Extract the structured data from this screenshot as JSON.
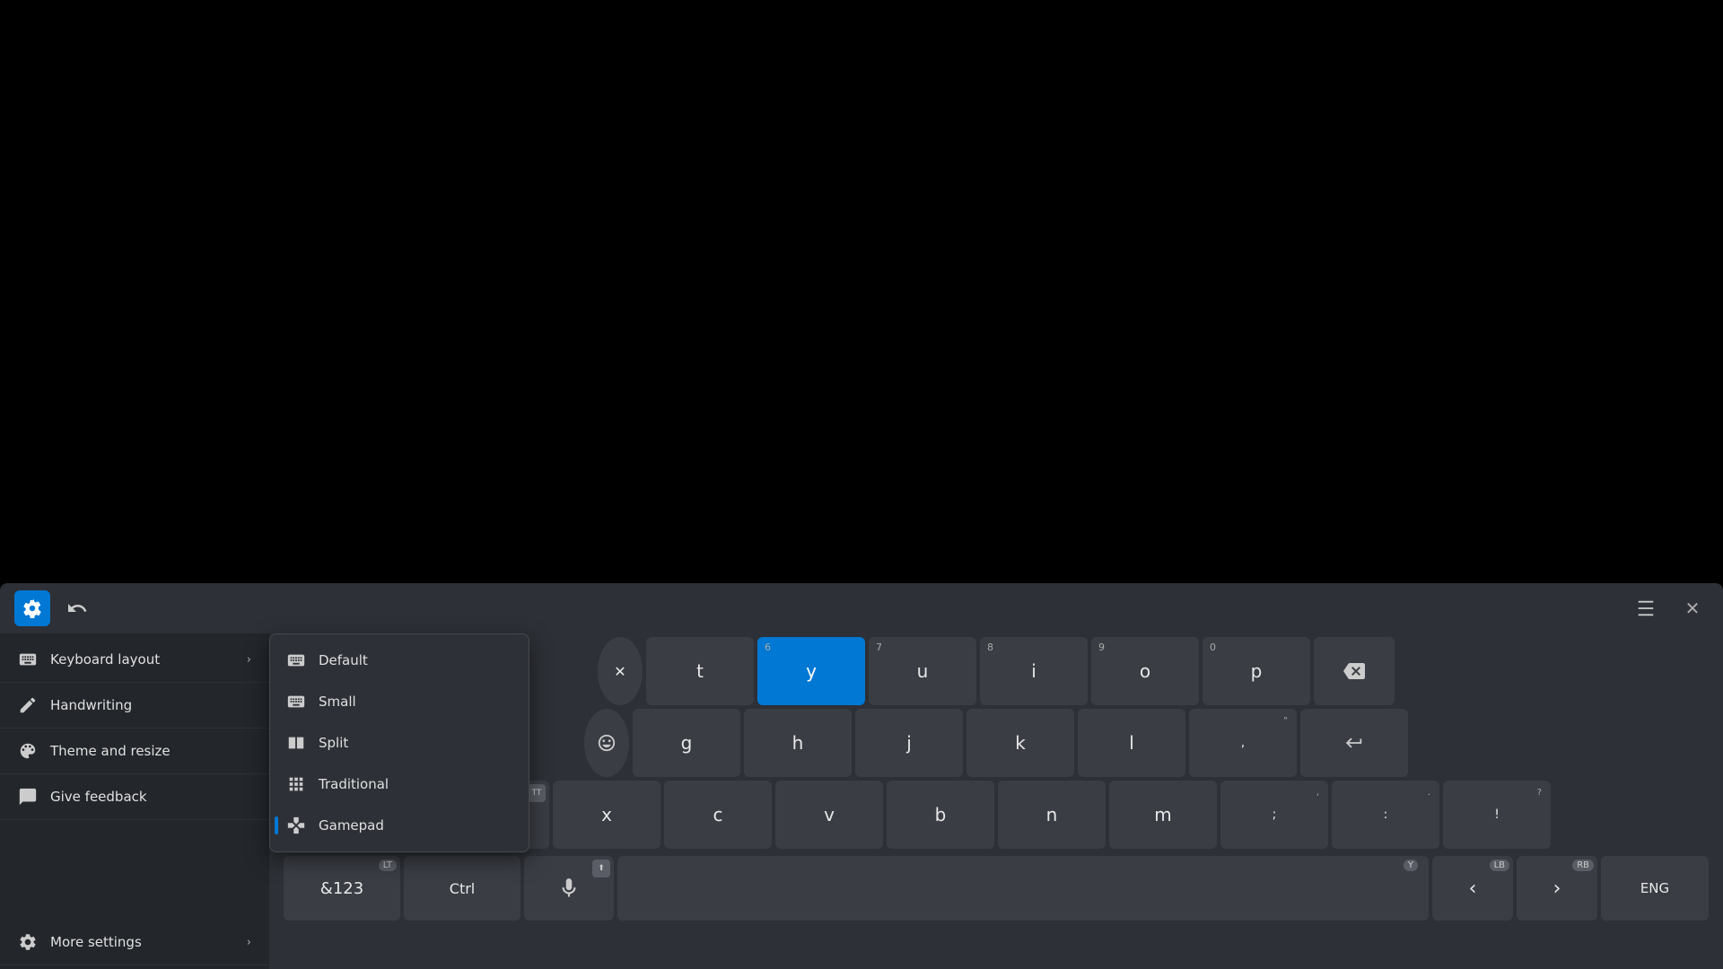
{
  "header": {
    "gear_label": "Settings",
    "dock_label": "Dock",
    "close_label": "Close"
  },
  "sidebar": {
    "items": [
      {
        "id": "keyboard-layout",
        "label": "Keyboard layout",
        "has_chevron": true
      },
      {
        "id": "handwriting",
        "label": "Handwriting",
        "has_chevron": false
      },
      {
        "id": "theme-resize",
        "label": "Theme and resize",
        "has_chevron": false
      },
      {
        "id": "give-feedback",
        "label": "Give feedback",
        "has_chevron": false
      },
      {
        "id": "more-settings",
        "label": "More settings",
        "has_chevron": true
      }
    ]
  },
  "dropdown": {
    "items": [
      {
        "id": "default",
        "label": "Default",
        "selected": false
      },
      {
        "id": "small",
        "label": "Small",
        "selected": false
      },
      {
        "id": "split",
        "label": "Split",
        "selected": false
      },
      {
        "id": "traditional",
        "label": "Traditional",
        "selected": false
      },
      {
        "id": "gamepad",
        "label": "Gamepad",
        "selected": true
      }
    ]
  },
  "keys": {
    "row1": [
      {
        "char": "t",
        "num": ""
      },
      {
        "char": "y",
        "num": "6",
        "highlighted": true
      },
      {
        "char": "u",
        "num": "7"
      },
      {
        "char": "i",
        "num": "8"
      },
      {
        "char": "o",
        "num": "9"
      },
      {
        "char": "p",
        "num": "0"
      }
    ],
    "row2": [
      {
        "char": "g",
        "num": ""
      },
      {
        "char": "h",
        "num": ""
      },
      {
        "char": "j",
        "num": ""
      },
      {
        "char": "k",
        "num": ""
      },
      {
        "char": "l",
        "num": ""
      },
      {
        "char": ",",
        "num": ""
      }
    ],
    "row3": [
      {
        "char": "x",
        "num": ""
      },
      {
        "char": "c",
        "num": ""
      },
      {
        "char": "v",
        "num": ""
      },
      {
        "char": "b",
        "num": ""
      },
      {
        "char": "n",
        "num": ""
      },
      {
        "char": "m",
        "num": ""
      },
      {
        "char": ";,",
        "num": ""
      },
      {
        "char": ":.",
        "num": ""
      },
      {
        "char": "!?",
        "num": ""
      }
    ],
    "bottom": {
      "num": "&123",
      "ctrl": "Ctrl",
      "mic": "🎤",
      "space": "",
      "arrow_left": "‹",
      "arrow_right": "›",
      "lang": "ENG"
    }
  },
  "badges": {
    "lt": "LT",
    "lb": "LB",
    "rb": "RB",
    "y": "Y",
    "tt": "TT"
  }
}
